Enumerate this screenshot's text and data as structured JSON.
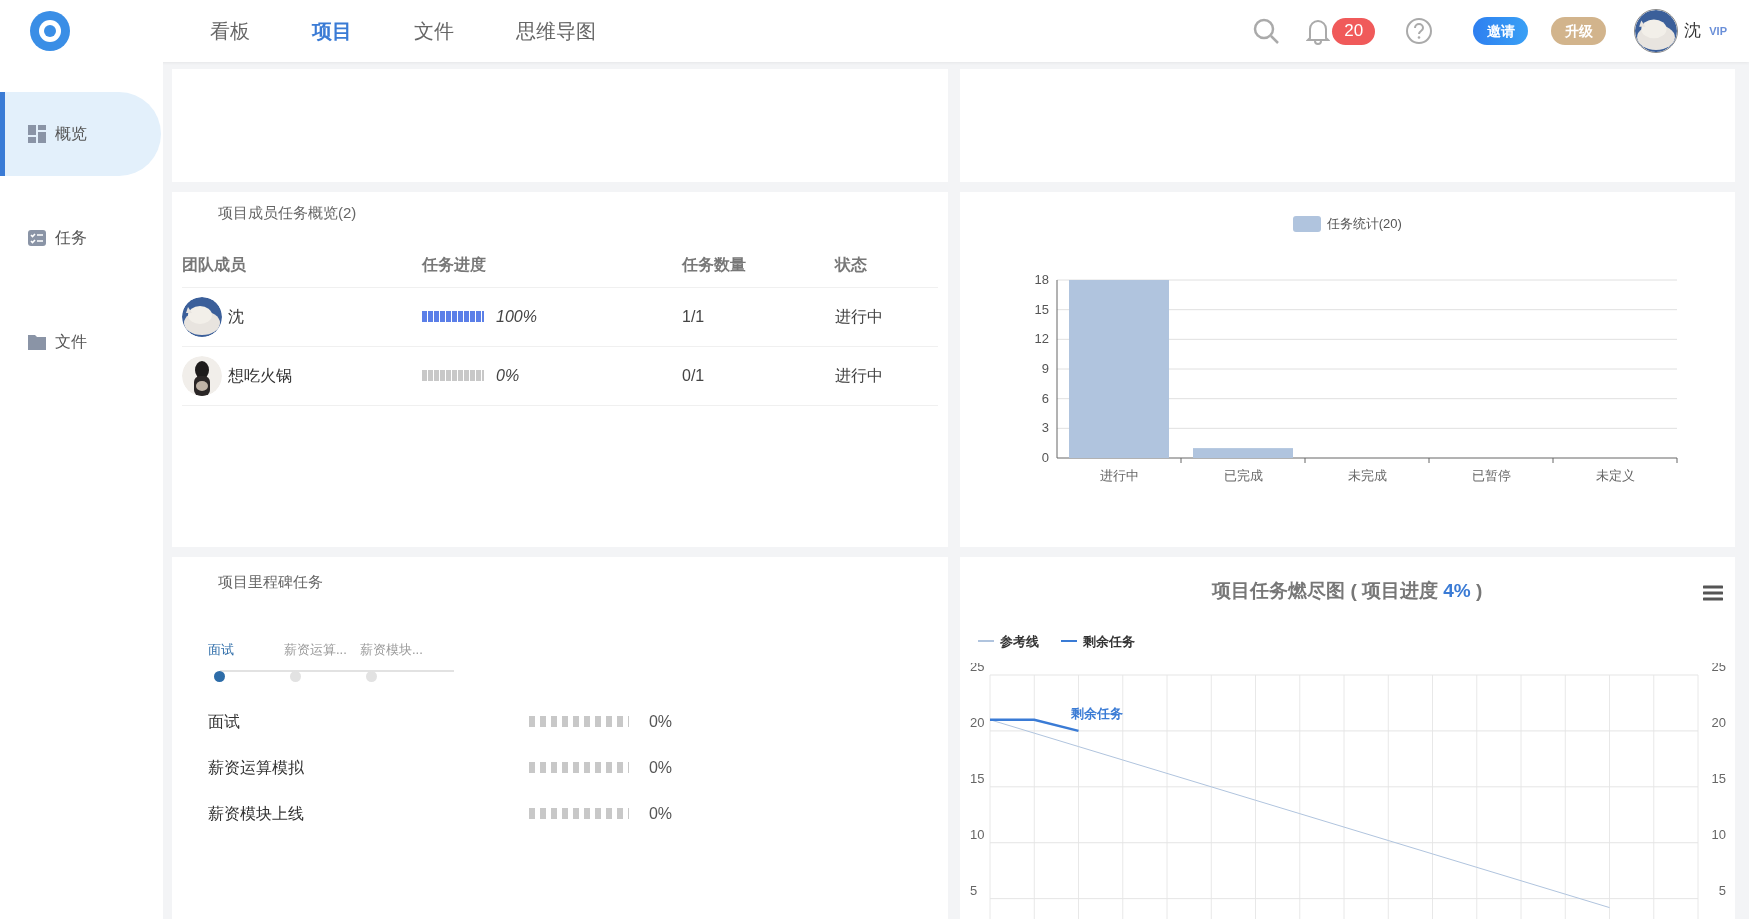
{
  "nav": {
    "tabs": [
      {
        "label": "看板",
        "selected": false
      },
      {
        "label": "项目",
        "selected": true
      },
      {
        "label": "文件",
        "selected": false
      },
      {
        "label": "思维导图",
        "selected": false
      }
    ],
    "notification_count": "20",
    "invite_button": "邀请",
    "upgrade_button": "升级",
    "user_name": "沈",
    "user_badge": "VIP"
  },
  "sidebar": {
    "items": [
      {
        "label": "概览",
        "selected": true
      },
      {
        "label": "任务",
        "selected": false
      },
      {
        "label": "文件",
        "selected": false
      }
    ]
  },
  "members": {
    "title": "项目成员任务概览(2)",
    "columns": [
      "团队成员",
      "任务进度",
      "任务数量",
      "状态"
    ],
    "rows": [
      {
        "name": "沈",
        "level": 1,
        "progress": "100%",
        "count": "1/1",
        "status": "进行中"
      },
      {
        "name": "想吃火锅",
        "level": 0,
        "progress": "0%",
        "count": "0/1",
        "status": "进行中"
      }
    ]
  },
  "task_stats": {
    "chart_data": {
      "type": "bar",
      "categories": [
        "进行中",
        "已完成",
        "未完成",
        "已暂停",
        "未定义"
      ],
      "series": [
        {
          "name": "任务统计(20)",
          "color": "#b0c4de",
          "values": [
            18,
            1,
            0,
            0,
            0
          ]
        }
      ],
      "ylim": [
        0,
        18
      ],
      "yticks": [
        0,
        3,
        6,
        9,
        12,
        15,
        18
      ],
      "grid": true
    }
  },
  "milestones": {
    "title": "项目里程碑任务",
    "steps": [
      {
        "label": "面试",
        "selected": true
      },
      {
        "label": "薪资运算...",
        "selected": false
      },
      {
        "label": "薪资模块...",
        "selected": false
      }
    ],
    "rows": [
      {
        "name": "面试",
        "level": 0,
        "progress": "0%"
      },
      {
        "name": "薪资运算模拟",
        "level": 0,
        "progress": "0%"
      },
      {
        "name": "薪资模块上线",
        "level": 0,
        "progress": "0%"
      }
    ]
  },
  "burndown": {
    "title": "项目任务燃尽图 ( 项目进度 ",
    "title_value": "4%",
    "title_end": " )",
    "chart_data": {
      "type": "line",
      "ylim": [
        3,
        25
      ],
      "yticks": [
        5,
        10,
        15,
        20,
        25
      ],
      "y2lim": [
        3,
        25
      ],
      "y2ticks": [
        5,
        10,
        15,
        20,
        25
      ],
      "grid": true,
      "series": [
        {
          "name": "参考线",
          "color": "#b0c4de",
          "values": [
            21,
            19.8,
            18.6,
            17.4,
            16.2,
            15,
            13.8,
            12.6,
            11.4,
            10.2,
            9,
            7.8,
            6.6,
            5.4,
            4.2,
            null,
            null
          ]
        },
        {
          "name": "剩余任务",
          "color": "#3a7bd5",
          "values": [
            21,
            21,
            20,
            null,
            null,
            null,
            null,
            null,
            null,
            null,
            null,
            null,
            null,
            null,
            null,
            null,
            null
          ]
        }
      ],
      "annotations": [
        "剩余任务"
      ]
    }
  }
}
